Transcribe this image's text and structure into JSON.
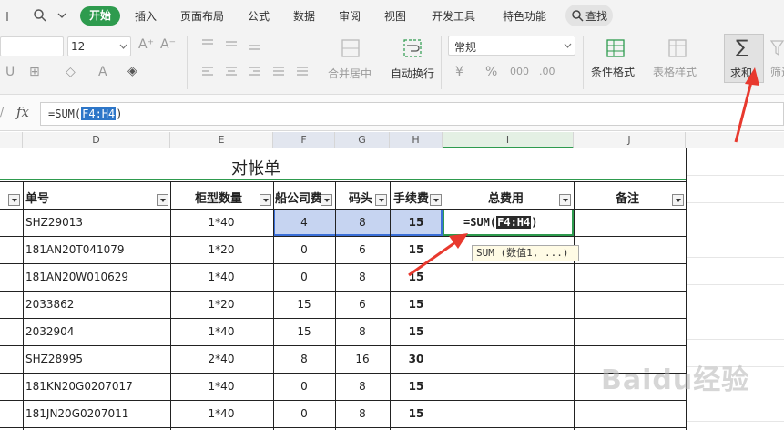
{
  "menubar": {
    "tabs": [
      "开始",
      "插入",
      "页面布局",
      "公式",
      "数据",
      "审阅",
      "视图",
      "开发工具",
      "特色功能"
    ],
    "search_label": "查找"
  },
  "ribbon": {
    "font_size": "12",
    "merge_center": "合并居中",
    "wrap_text": "自动换行",
    "number_format": "常规",
    "conditional_format": "条件格式",
    "table_style": "表格样式",
    "sum_label": "求和",
    "filter_label": "筛选",
    "currency_symbol": "¥",
    "percent_symbol": "%"
  },
  "formula_bar": {
    "fx": "fx",
    "prefix": "=SUM(",
    "range": "F4:H4",
    "suffix": ")"
  },
  "columns": [
    "D",
    "E",
    "F",
    "G",
    "H",
    "I",
    "J"
  ],
  "sheet": {
    "title": "对帐单",
    "headers": {
      "order_no": "单号",
      "container": "柜型数量",
      "ship_fee": "船公司费",
      "dock": "码头",
      "handling": "手续费",
      "total": "总费用",
      "remark": "备注"
    },
    "rows": [
      {
        "order": "SHZ29013",
        "container": "1*40",
        "ship": "4",
        "dock": "8",
        "handling": "15"
      },
      {
        "order": "181AN20T041079",
        "container": "1*20",
        "ship": "0",
        "dock": "6",
        "handling": "15"
      },
      {
        "order": "181AN20W010629",
        "container": "1*40",
        "ship": "0",
        "dock": "8",
        "handling": "15"
      },
      {
        "order": "2033862",
        "container": "1*20",
        "ship": "15",
        "dock": "6",
        "handling": "15"
      },
      {
        "order": "2032904",
        "container": "1*40",
        "ship": "15",
        "dock": "8",
        "handling": "15"
      },
      {
        "order": "SHZ28995",
        "container": "2*40",
        "ship": "8",
        "dock": "16",
        "handling": "30"
      },
      {
        "order": "181KN20G0207017",
        "container": "1*40",
        "ship": "0",
        "dock": "8",
        "handling": "15"
      },
      {
        "order": "181JN20G0207011",
        "container": "1*40",
        "ship": "0",
        "dock": "8",
        "handling": "15"
      }
    ],
    "active_cell_formula": {
      "prefix": "=SUM(",
      "range": "F4:H4",
      "suffix": ")"
    },
    "tooltip": "SUM (数值1, ...)"
  },
  "watermark": "Baidu经验",
  "colors": {
    "accent_green": "#2e9b4e",
    "selection_blue": "#c6d4f1",
    "arrow_red": "#e8392e"
  }
}
